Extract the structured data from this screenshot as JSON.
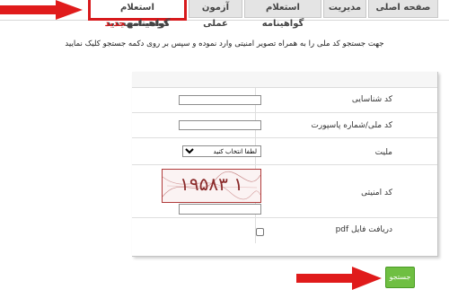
{
  "tabs": [
    {
      "label": "صفحه اصلی"
    },
    {
      "label": "مدیریت"
    },
    {
      "label": "استعلام گواهینامه"
    },
    {
      "label": "آزمون عملی"
    },
    {
      "label": "استعلام گواهینامه",
      "badge": "جدید"
    }
  ],
  "instruction": "جهت جستجو کد ملی را به همراه تصویر امنیتی وارد نموده و سپس بر روی دکمه جستجو کلیک نمایید",
  "form": {
    "tracking_code_label": "کد شناسایی",
    "national_id_label": "کد ملی/شماره پاسپورت",
    "nationality_label": "ملیت",
    "nationality_selected": "لطفا انتخاب کنید",
    "captcha_label": "کد امنیتی",
    "captcha_text": "۱۹۵۸۳ ۱",
    "pdf_label": "دریافت فایل pdf"
  },
  "search_button": {
    "label": "جستجو ✓"
  },
  "colors": {
    "highlight": "#d7191c",
    "button": "#6fbf42"
  }
}
